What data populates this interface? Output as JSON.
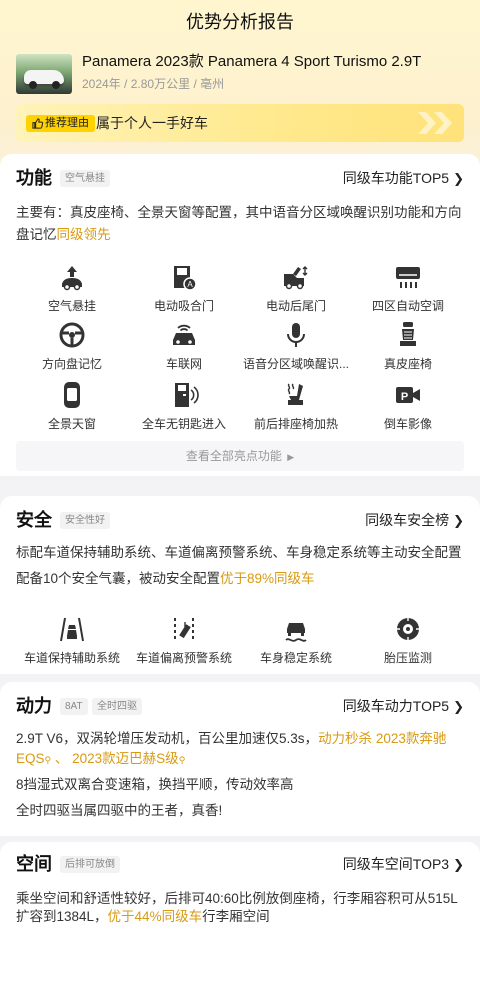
{
  "page": {
    "title": "优势分析报告"
  },
  "car": {
    "name": "Panamera 2023款 Panamera 4 Sport Turismo 2.9T",
    "year": "2024年",
    "mileage": "2.80万公里",
    "city": "亳州",
    "sep": "/"
  },
  "reason": {
    "tag": "推荐理由",
    "text": "属于个人一手好车"
  },
  "function": {
    "title": "功能",
    "chip": "空气悬挂",
    "top_link": "同级车功能TOP5",
    "desc_main": "主要有：真皮座椅、全景天窗等配置，其中语音分区域唤醒识别功能和方向盘记忆",
    "desc_highlight": "同级领先",
    "items": [
      {
        "label": "空气悬挂",
        "icon": "air-suspension-icon"
      },
      {
        "label": "电动吸合门",
        "icon": "soft-close-door-icon"
      },
      {
        "label": "电动后尾门",
        "icon": "power-tailgate-icon"
      },
      {
        "label": "四区自动空调",
        "icon": "climate-control-icon"
      },
      {
        "label": "方向盘记忆",
        "icon": "steering-wheel-icon"
      },
      {
        "label": "车联网",
        "icon": "connected-car-icon"
      },
      {
        "label": "语音分区域唤醒识...",
        "icon": "microphone-icon"
      },
      {
        "label": "真皮座椅",
        "icon": "leather-seat-icon"
      },
      {
        "label": "全景天窗",
        "icon": "panoramic-sunroof-icon"
      },
      {
        "label": "全车无钥匙进入",
        "icon": "keyless-entry-icon"
      },
      {
        "label": "前后排座椅加热",
        "icon": "seat-heating-icon"
      },
      {
        "label": "倒车影像",
        "icon": "reverse-camera-icon"
      }
    ],
    "see_all": "查看全部亮点功能"
  },
  "safety": {
    "title": "安全",
    "chip": "安全性好",
    "top_link": "同级车安全榜",
    "line1": "标配车道保持辅助系统、车道偏离预警系统、车身稳定系统等主动安全配置",
    "line2_main": "配备10个安全气囊，被动安全配置",
    "line2_highlight": "优于89%同级车",
    "items": [
      {
        "label": "车道保持辅助系统",
        "icon": "lane-keep-icon"
      },
      {
        "label": "车道偏离预警系统",
        "icon": "lane-departure-icon"
      },
      {
        "label": "车身稳定系统",
        "icon": "stability-control-icon"
      },
      {
        "label": "胎压监测",
        "icon": "tire-pressure-icon"
      }
    ]
  },
  "power": {
    "title": "动力",
    "chips": [
      "8AT",
      "全时四驱"
    ],
    "top_link": "同级车动力TOP5",
    "line1_main": "2.9T V6，双涡轮增压发动机，百公里加速仅5.3s，",
    "line1_highlight": "动力秒杀 2023款奔驰",
    "line2_link1": "EQS",
    "line2_sep": "、",
    "line2_link2": "2023款迈巴赫S级",
    "line3": "8挡湿式双离合变速箱，换挡平顺，传动效率高",
    "line4": "全时四驱当属四驱中的王者，真香!"
  },
  "space": {
    "title": "空间",
    "chip": "后排可放倒",
    "top_link": "同级车空间TOP3",
    "line1": "乘坐空间和舒适性较好，后排可40:60比例放倒座椅，行李厢容积可从515L",
    "line2_main": "扩容到1384L，",
    "line2_highlight": "优于44%同级车",
    "line2_tail": "行李厢空间"
  },
  "colors": {
    "accent": "#d79a12",
    "tag_yellow": "#ffd200",
    "text": "#222222"
  }
}
